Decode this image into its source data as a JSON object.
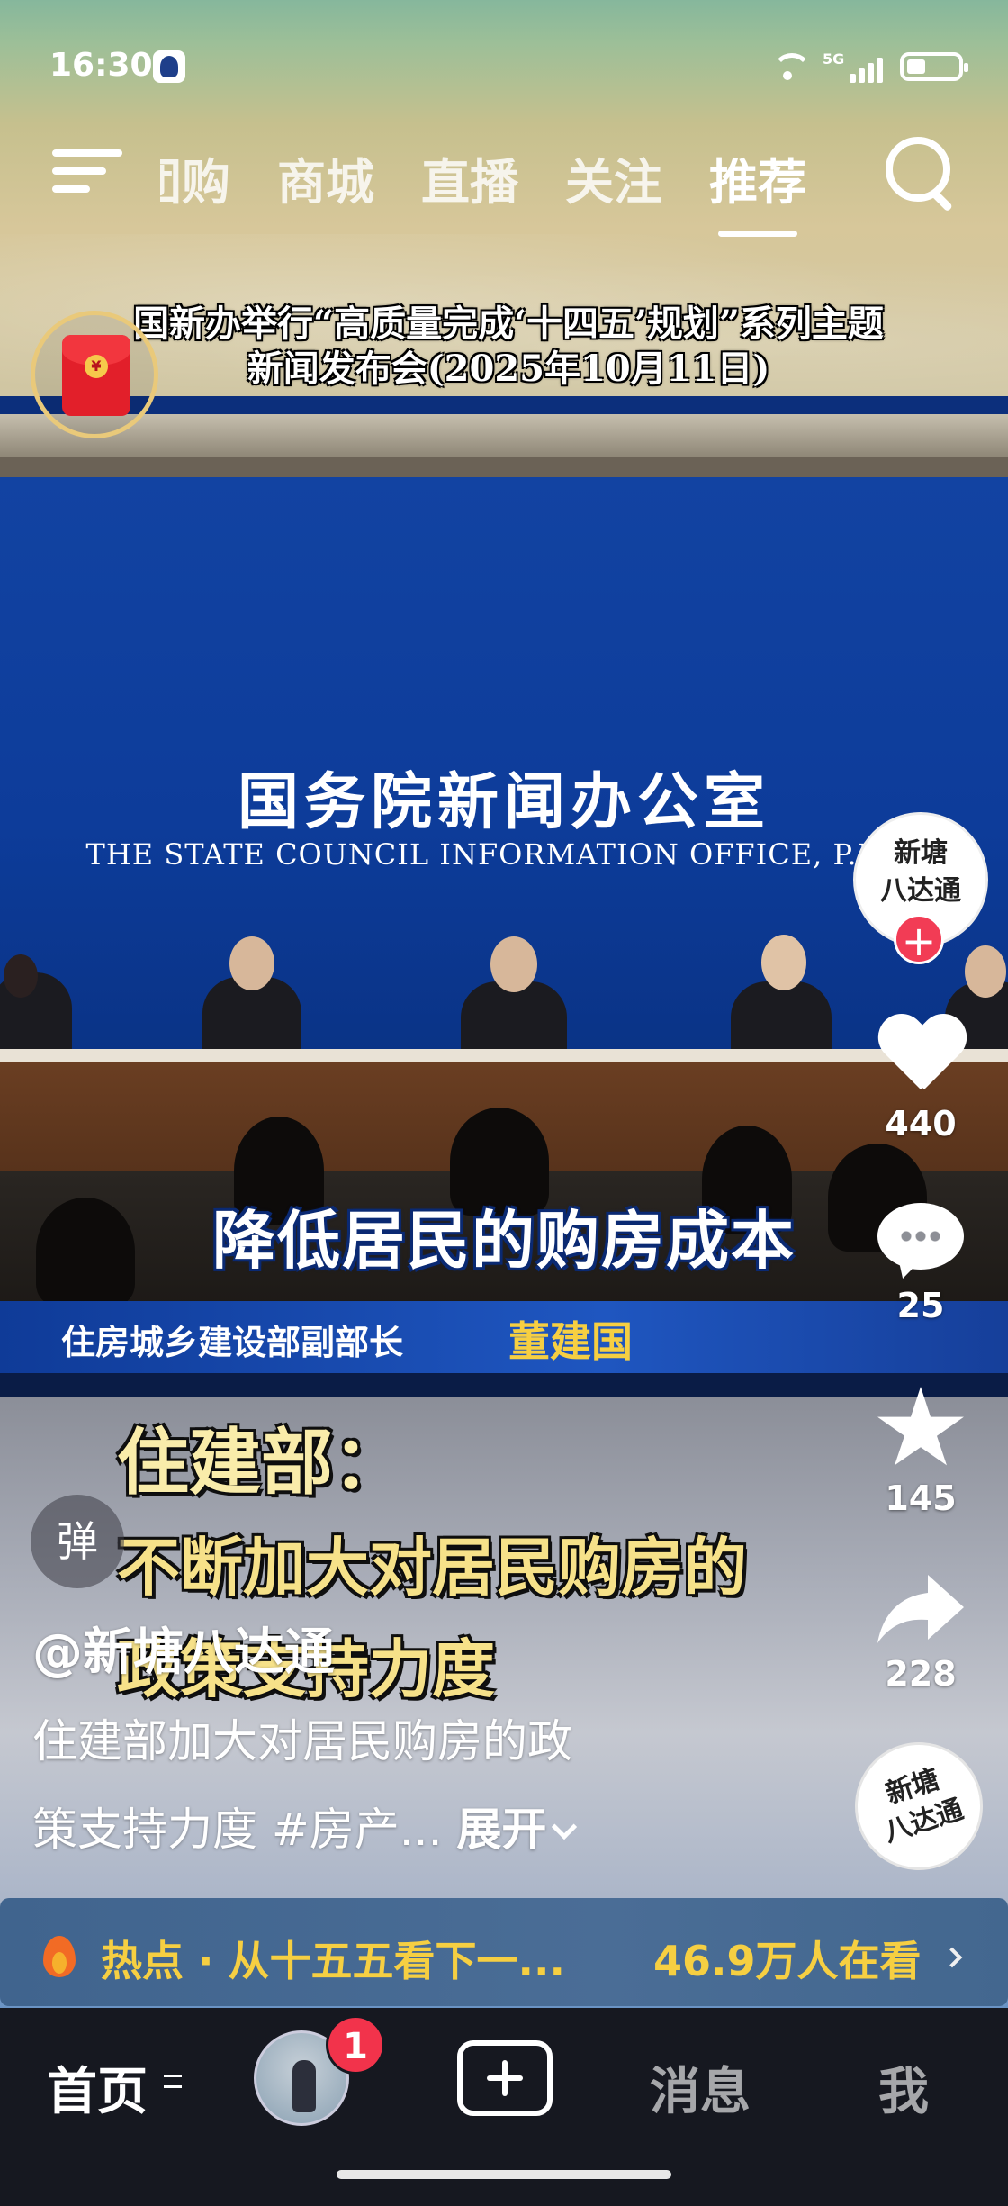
{
  "status_bar": {
    "time": "16:30",
    "network": "5G"
  },
  "top_nav": {
    "tabs": [
      {
        "label": "团购",
        "state": "partially-hidden"
      },
      {
        "label": "商城",
        "state": "normal"
      },
      {
        "label": "直播",
        "state": "normal"
      },
      {
        "label": "关注",
        "state": "normal"
      },
      {
        "label": "推荐",
        "state": "active"
      }
    ],
    "icons": [
      "menu-icon",
      "search-icon"
    ]
  },
  "video": {
    "title_line1": "国新办举行“高质量完成‘十四五’规划”系列主题",
    "title_line2": "新闻发布会(2025年10月11日)",
    "office_cn": "国务院新闻办公室",
    "office_en": "THE STATE COUNCIL INFORMATION OFFICE, P.R.C.",
    "caption": "降低居民的购房成本",
    "speaker_title": "住房城乡建设部副部长",
    "speaker_name": "董建国",
    "headline_1": "住建部：",
    "headline_2": "不断加大对居民购房的",
    "headline_3": "政策支持力度"
  },
  "danmaku": {
    "label": "弹"
  },
  "rail": {
    "author_avatar_text": [
      "新塘",
      "八达通"
    ],
    "follow_symbol": "+",
    "likes": "440",
    "comments": "25",
    "favorites": "145",
    "shares": "228",
    "music_disc_text": [
      "新塘",
      "八达通"
    ]
  },
  "post": {
    "author": "@新塘八达通",
    "desc_line1": "住建部加大对居民购房的政",
    "desc_line2": "策支持力度 #房产...",
    "expand": "展开"
  },
  "hot_banner": {
    "text": "热点 · 从十五五看下一...",
    "viewers": "46.9万人在看"
  },
  "bottom_nav": {
    "home": "首页",
    "badge": "1",
    "messages": "消息",
    "me": "我"
  },
  "colors": {
    "accent_yellow": "#f6cf42",
    "badge_red": "#f2334b",
    "video_blue": "#0d3c9a"
  }
}
